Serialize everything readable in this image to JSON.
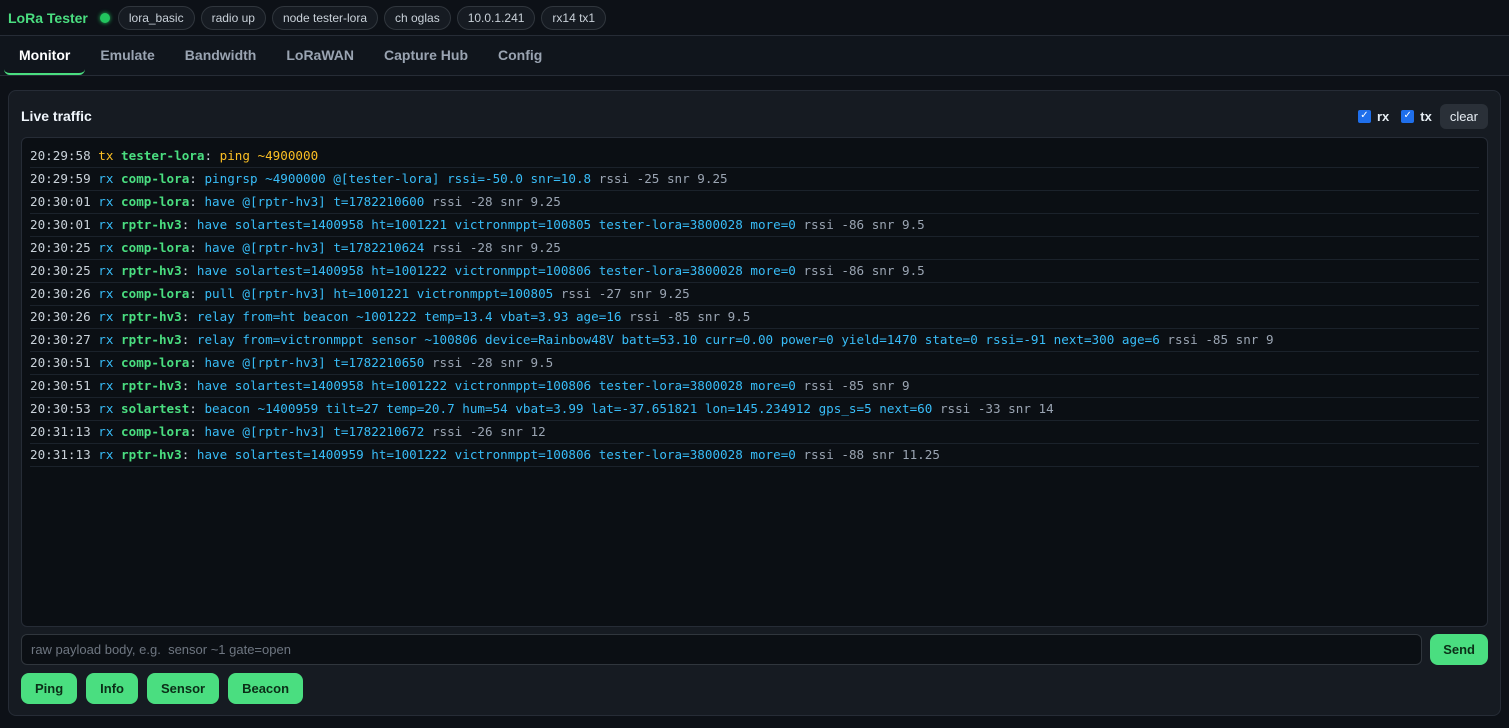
{
  "app": {
    "title": "LoRa Tester",
    "status_color": "#22c55e",
    "pills": [
      "lora_basic",
      "radio up",
      "node tester-lora",
      "ch oglas",
      "10.0.1.241",
      "rx14 tx1"
    ]
  },
  "tabs": [
    {
      "label": "Monitor",
      "active": true
    },
    {
      "label": "Emulate",
      "active": false
    },
    {
      "label": "Bandwidth",
      "active": false
    },
    {
      "label": "LoRaWAN",
      "active": false
    },
    {
      "label": "Capture Hub",
      "active": false
    },
    {
      "label": "Config",
      "active": false
    }
  ],
  "panel": {
    "title": "Live traffic",
    "filters": [
      {
        "label": "rx",
        "checked": true
      },
      {
        "label": "tx",
        "checked": true
      }
    ],
    "clear_label": "clear"
  },
  "log": [
    {
      "ts": "20:29:58",
      "dir": "tx",
      "node": "tester-lora",
      "msg": "ping ~4900000",
      "sig": ""
    },
    {
      "ts": "20:29:59",
      "dir": "rx",
      "node": "comp-lora",
      "msg": "pingrsp ~4900000 @[tester-lora] rssi=-50.0 snr=10.8",
      "sig": "rssi -25 snr 9.25"
    },
    {
      "ts": "20:30:01",
      "dir": "rx",
      "node": "comp-lora",
      "msg": "have @[rptr-hv3] t=1782210600",
      "sig": "rssi -28 snr 9.25"
    },
    {
      "ts": "20:30:01",
      "dir": "rx",
      "node": "rptr-hv3",
      "msg": "have solartest=1400958 ht=1001221 victronmppt=100805 tester-lora=3800028 more=0",
      "sig": "rssi -86 snr 9.5"
    },
    {
      "ts": "20:30:25",
      "dir": "rx",
      "node": "comp-lora",
      "msg": "have @[rptr-hv3] t=1782210624",
      "sig": "rssi -28 snr 9.25"
    },
    {
      "ts": "20:30:25",
      "dir": "rx",
      "node": "rptr-hv3",
      "msg": "have solartest=1400958 ht=1001222 victronmppt=100806 tester-lora=3800028 more=0",
      "sig": "rssi -86 snr 9.5"
    },
    {
      "ts": "20:30:26",
      "dir": "rx",
      "node": "comp-lora",
      "msg": "pull @[rptr-hv3] ht=1001221 victronmppt=100805",
      "sig": "rssi -27 snr 9.25"
    },
    {
      "ts": "20:30:26",
      "dir": "rx",
      "node": "rptr-hv3",
      "msg": "relay from=ht beacon ~1001222 temp=13.4 vbat=3.93 age=16",
      "sig": "rssi -85 snr 9.5"
    },
    {
      "ts": "20:30:27",
      "dir": "rx",
      "node": "rptr-hv3",
      "msg": "relay from=victronmppt sensor ~100806 device=Rainbow48V batt=53.10 curr=0.00 power=0 yield=1470 state=0 rssi=-91 next=300 age=6",
      "sig": "rssi -85 snr 9"
    },
    {
      "ts": "20:30:51",
      "dir": "rx",
      "node": "comp-lora",
      "msg": "have @[rptr-hv3] t=1782210650",
      "sig": "rssi -28 snr 9.5"
    },
    {
      "ts": "20:30:51",
      "dir": "rx",
      "node": "rptr-hv3",
      "msg": "have solartest=1400958 ht=1001222 victronmppt=100806 tester-lora=3800028 more=0",
      "sig": "rssi -85 snr 9"
    },
    {
      "ts": "20:30:53",
      "dir": "rx",
      "node": "solartest",
      "msg": "beacon ~1400959 tilt=27 temp=20.7 hum=54 vbat=3.99 lat=-37.651821 lon=145.234912 gps_s=5 next=60",
      "sig": "rssi -33 snr 14"
    },
    {
      "ts": "20:31:13",
      "dir": "rx",
      "node": "comp-lora",
      "msg": "have @[rptr-hv3] t=1782210672",
      "sig": "rssi -26 snr 12"
    },
    {
      "ts": "20:31:13",
      "dir": "rx",
      "node": "rptr-hv3",
      "msg": "have solartest=1400959 ht=1001222 victronmppt=100806 tester-lora=3800028 more=0",
      "sig": "rssi -88 snr 11.25"
    }
  ],
  "composer": {
    "value": "",
    "placeholder": "raw payload body, e.g.  sensor ~1 gate=open",
    "send_label": "Send"
  },
  "quick_buttons": [
    "Ping",
    "Info",
    "Sensor",
    "Beacon"
  ]
}
